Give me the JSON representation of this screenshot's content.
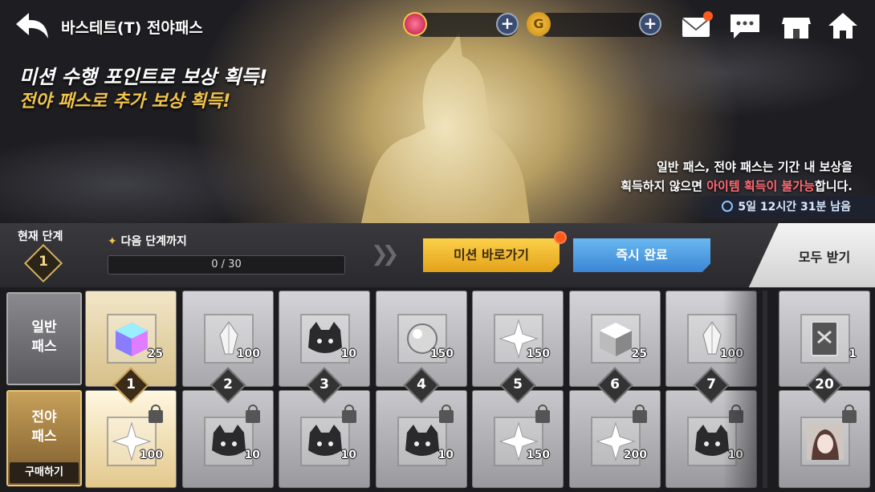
{
  "header": {
    "title": "바스테트(T) 전야패스",
    "back_icon": "back-arrow-icon"
  },
  "currency": [
    {
      "icon": "gem-icon",
      "value": ""
    },
    {
      "icon": "gold-coin-icon",
      "value": ""
    }
  ],
  "top_icons": [
    "mail-icon",
    "chat-icon",
    "shop-icon",
    "home-icon"
  ],
  "hero": {
    "headline1": "미션 수행 포인트로 보상 획득!",
    "headline2": "전야 패스로 추가 보상 획득!",
    "notice_line1": "일반 패스, 전야 패스는 기간 내 보상을",
    "notice_line2_pre": "획득하지 않으면 ",
    "notice_line2_warn": "아이템 획득이 불가능",
    "notice_line2_post": "합니다.",
    "timer": "5일 12시간 31분 남음"
  },
  "controls": {
    "current_stage_label": "현재 단계",
    "current_stage": "1",
    "next_stage_label": "다음 단계까지",
    "progress_text": "0 / 30",
    "progress": 0,
    "mission_button": "미션 바로가기",
    "instant_button": "즉시 완료",
    "claim_all_button": "모두 받기"
  },
  "tracks": {
    "normal_label": "일반\n패스",
    "war_label": "전야\n패스",
    "buy_label": "구매하기"
  },
  "steps": [
    {
      "step": "1",
      "normal": {
        "item": "rainbow-cube-icon",
        "qty": "25"
      },
      "war": {
        "item": "star-crystal-icon",
        "qty": "100"
      }
    },
    {
      "step": "2",
      "normal": {
        "item": "crystal-shard-icon",
        "qty": "100"
      },
      "war": {
        "item": "black-cat-helmet-icon",
        "qty": "10"
      }
    },
    {
      "step": "3",
      "normal": {
        "item": "black-cat-helmet-icon",
        "qty": "10"
      },
      "war": {
        "item": "black-cat-helmet-icon",
        "qty": "10"
      }
    },
    {
      "step": "4",
      "normal": {
        "item": "orb-icon",
        "qty": "150"
      },
      "war": {
        "item": "black-cat-helmet-icon",
        "qty": "10"
      }
    },
    {
      "step": "5",
      "normal": {
        "item": "star-crystal-icon",
        "qty": "150"
      },
      "war": {
        "item": "star-crystal-icon",
        "qty": "150"
      }
    },
    {
      "step": "6",
      "normal": {
        "item": "white-cube-icon",
        "qty": "25"
      },
      "war": {
        "item": "star-crystal-icon",
        "qty": "200"
      }
    },
    {
      "step": "7",
      "normal": {
        "item": "crystal-shard-icon",
        "qty": "100"
      },
      "war": {
        "item": "black-cat-helmet-icon",
        "qty": "10"
      }
    }
  ],
  "final_step": {
    "step": "20",
    "normal": {
      "item": "card-book-icon",
      "qty": "1"
    },
    "war": {
      "item": "character-portrait-icon",
      "qty": ""
    }
  },
  "colors": {
    "mission": "#f2b630",
    "instant": "#4a9be4",
    "warning": "#ff6b74",
    "accent_gold": "#f2c44b"
  }
}
